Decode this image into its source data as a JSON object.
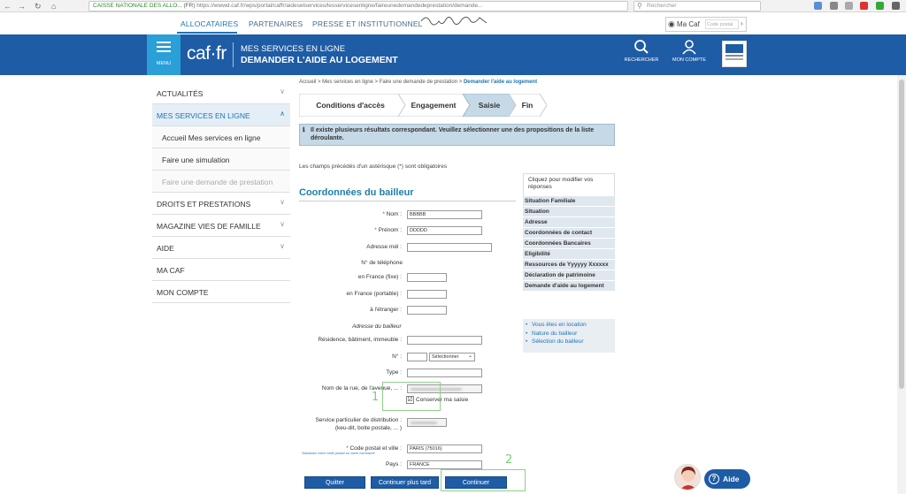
{
  "browser": {
    "back": "←",
    "forward": "→",
    "reload": "↻",
    "home": "⌂",
    "site_identity": "CAISSE NATIONALE DES ALLO...",
    "site_country": "(FR)",
    "url": "https://wwwd.caf.fr/wps/portal/caffr/aidesetservices/lesservicesenligne/faireunedemandedeprestation/demande...",
    "search_placeholder": "Rechercher"
  },
  "audience_nav": {
    "items": [
      "ALLOCATAIRES",
      "PARTENAIRES",
      "PRESSE ET INSTITUTIONNEL"
    ],
    "active": "ALLOCATAIRES"
  },
  "ma_caf": {
    "label": "Ma Caf",
    "postal_placeholder": "Code postal",
    "go": "›"
  },
  "header": {
    "menu_label": "MENU",
    "logo": "caf·fr",
    "subtitle1": "MES SERVICES EN LIGNE",
    "subtitle2": "DEMANDER L'AIDE AU LOGEMENT",
    "search_label": "RECHERCHER",
    "account_label": "MON COMPTE"
  },
  "sidebar": {
    "items": [
      {
        "label": "ACTUALITÉS",
        "chevron": "∨"
      },
      {
        "label": "MES SERVICES EN LIGNE",
        "chevron": "∧"
      },
      {
        "label": "DROITS ET PRESTATIONS",
        "chevron": "∨"
      },
      {
        "label": "MAGAZINE VIES DE FAMILLE",
        "chevron": "∨"
      },
      {
        "label": "AIDE",
        "chevron": "∨"
      },
      {
        "label": "MA CAF"
      },
      {
        "label": "MON COMPTE"
      }
    ],
    "subitems": [
      "Accueil Mes services en ligne",
      "Faire une simulation",
      "Faire une demande de prestation"
    ]
  },
  "breadcrumb": {
    "path": "Accueil > Mes services en ligne > Faire une demande de prestation > ",
    "current": "Demander l'aide au logement"
  },
  "steps": [
    "Conditions d'accès",
    "Engagement",
    "Saisie",
    "Fin"
  ],
  "active_step": "Saisie",
  "info_message": "Il existe plusieurs résultats correspondant. Veuillez sélectionner une des propositions de la liste déroulante.",
  "info_icon": "ℹ",
  "required_note": "Les champs précédés d'un astérisque (*) sont obligatoires",
  "form": {
    "title": "Coordonnées du bailleur",
    "labels": {
      "nom": "Nom :",
      "prenom": "Prénom :",
      "email": "Adresse mél :",
      "phone_heading": "N° de téléphone",
      "phone_fixe": "en France (fixe) :",
      "phone_portable": "en France (portable) :",
      "phone_etranger": "à l'étranger :",
      "address_heading": "Adresse du bailleur",
      "residence": "Résidence, bâtiment, immeuble :",
      "numero": "N° :",
      "type": "Type :",
      "rue": "Nom de la rue, de l'avenue, ... :",
      "service_line1": "Service particulier de distribution :",
      "service_line2": "(keu-dit, boite postale, ... )",
      "cp_ville": "Code postal et ville :",
      "pays": "Pays :"
    },
    "values": {
      "nom": "BBBBB",
      "prenom": "DDDDD",
      "numero_select": "Sélectionner",
      "cp_ville": "PARIS (75016)",
      "pays": "FRANCE"
    },
    "required_star": "*",
    "conserver_label": "Conserver ma saisie",
    "conserver_checked": "☑",
    "cp_hint": "Saisissez votre code postal ou votre commune"
  },
  "annotations": [
    "1",
    "2"
  ],
  "buttons": {
    "quit": "Quitter",
    "later": "Continuer plus tard",
    "continue": "Continuer"
  },
  "right_panel": {
    "header": "Cliquez pour modifier vos réponses",
    "items": [
      "Situation Familiale",
      "Situation",
      "Adresse",
      "Coordonnées de contact",
      "Coordonnées Bancaires",
      "Eligibilité",
      "Ressources de Yyyyyy Xxxxxx",
      "Déclaration de patrimoine",
      "Demande d'aide au logement"
    ],
    "subitems": [
      "Vous êtes en location",
      "Nature du bailleur",
      "Sélection du bailleur"
    ]
  },
  "help": {
    "label": "Aide",
    "icon": "?"
  },
  "colors": {
    "brand_blue": "#1e5ca5",
    "menu_blue": "#2a9fd8",
    "title_teal": "#1e7fa8",
    "annotation_green": "#8fd18a"
  }
}
